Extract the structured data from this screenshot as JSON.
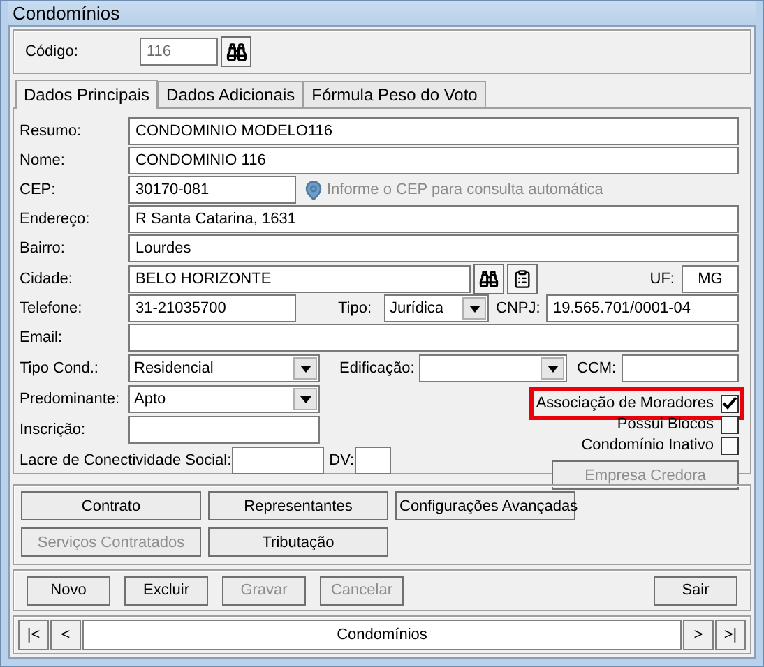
{
  "window": {
    "title": "Condomínios"
  },
  "codigo": {
    "label": "Código:",
    "value": "116",
    "disabled": true
  },
  "tabs": [
    {
      "label": "Dados Principais",
      "selected": true
    },
    {
      "label": "Dados Adicionais",
      "selected": false
    },
    {
      "label": "Fórmula Peso do Voto",
      "selected": false
    }
  ],
  "form": {
    "resumo": {
      "label": "Resumo:",
      "value": "CONDOMINIO MODELO116"
    },
    "nome": {
      "label": "Nome:",
      "value": "CONDOMINIO 116"
    },
    "cep": {
      "label": "CEP:",
      "value": "30170-081",
      "hint": "Informe o CEP para consulta automática"
    },
    "endereco": {
      "label": "Endereço:",
      "value": "R Santa Catarina, 1631"
    },
    "bairro": {
      "label": "Bairro:",
      "value": "Lourdes"
    },
    "cidade": {
      "label": "Cidade:",
      "value": "BELO HORIZONTE"
    },
    "uf": {
      "label": "UF:",
      "value": "MG"
    },
    "telefone": {
      "label": "Telefone:",
      "value": "31-21035700"
    },
    "tipo": {
      "label": "Tipo:",
      "value": "Jurídica"
    },
    "cnpj": {
      "label": "CNPJ:",
      "value": "19.565.701/0001-04"
    },
    "email": {
      "label": "Email:"
    },
    "tipo_cond": {
      "label": "Tipo Cond.:",
      "value": "Residencial"
    },
    "edificacao": {
      "label": "Edificação:"
    },
    "ccm": {
      "label": "CCM:"
    },
    "predominante": {
      "label": "Predominante:",
      "value": "Apto"
    },
    "inscricao": {
      "label": "Inscrição:"
    },
    "lacre": {
      "label": "Lacre de Conectividade Social:"
    },
    "dv": {
      "label": "DV:"
    },
    "checkboxes": [
      {
        "label": "Associação de Moradores",
        "checked": true,
        "highlighted": true
      },
      {
        "label": "Possui Blocos",
        "checked": false,
        "highlighted": false
      },
      {
        "label": "Condomínio Inativo",
        "checked": false,
        "highlighted": false
      }
    ],
    "empresa_credora": {
      "label": "Empresa Credora",
      "disabled": true
    }
  },
  "action_buttons": [
    {
      "label": "Contrato",
      "disabled": false
    },
    {
      "label": "Representantes",
      "disabled": false
    },
    {
      "label": "Configurações Avançadas",
      "disabled": false
    },
    {
      "label": "Serviços Contratados",
      "disabled": true
    },
    {
      "label": "Tributação",
      "disabled": false
    }
  ],
  "toolbar_buttons": [
    {
      "label": "Novo",
      "disabled": false
    },
    {
      "label": "Excluir",
      "disabled": false
    },
    {
      "label": "Gravar",
      "disabled": true
    },
    {
      "label": "Cancelar",
      "disabled": true
    }
  ],
  "exit_button": {
    "label": "Sair"
  },
  "navigator": {
    "prev_buttons": [
      "|<",
      "<"
    ],
    "title": "Condomínios",
    "next_buttons": [
      ">",
      ">|"
    ]
  }
}
